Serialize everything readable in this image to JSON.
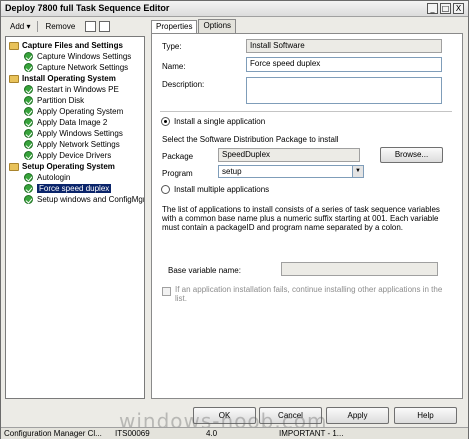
{
  "window": {
    "title": "Deploy 7800 full Task Sequence Editor",
    "controls": [
      "_",
      "□",
      "X"
    ]
  },
  "toolbar": {
    "add_label": "Add",
    "remove_label": "Remove"
  },
  "tree": {
    "items": [
      {
        "label": "Capture Files and Settings",
        "type": "group"
      },
      {
        "label": "Capture Windows Settings",
        "type": "step"
      },
      {
        "label": "Capture Network Settings",
        "type": "step"
      },
      {
        "label": "Install Operating System",
        "type": "group"
      },
      {
        "label": "Restart in Windows PE",
        "type": "step"
      },
      {
        "label": "Partition Disk",
        "type": "step"
      },
      {
        "label": "Apply Operating System",
        "type": "step"
      },
      {
        "label": "Apply Data Image 2",
        "type": "step"
      },
      {
        "label": "Apply Windows Settings",
        "type": "step"
      },
      {
        "label": "Apply Network Settings",
        "type": "step"
      },
      {
        "label": "Apply Device Drivers",
        "type": "step"
      },
      {
        "label": "Setup Operating System",
        "type": "group"
      },
      {
        "label": "Autologin",
        "type": "step"
      },
      {
        "label": "Force speed duplex",
        "type": "step",
        "selected": true
      },
      {
        "label": "Setup windows and ConfigMgr",
        "type": "step"
      }
    ]
  },
  "tabs": {
    "properties": "Properties",
    "options": "Options"
  },
  "props": {
    "type_label": "Type:",
    "type_value": "Install Software",
    "name_label": "Name:",
    "name_value": "Force speed duplex",
    "description_label": "Description:",
    "description_value": "",
    "radio_single": "Install a single application",
    "select_package_text": "Select the Software Distribution Package to install",
    "package_label": "Package",
    "package_value": "SpeedDuplex",
    "browse_label": "Browse...",
    "program_label": "Program",
    "program_value": "setup",
    "radio_multiple": "Install multiple applications",
    "multiple_desc": "The list of applications to install consists of a series of task sequence variables with a common base name plus a numeric suffix starting at 001.  Each variable must contain a packageID and program name separated by a colon.",
    "base_variable_label": "Base variable name:",
    "base_variable_value": "",
    "continue_checkbox": "If an application installation fails, continue installing other applications in the list."
  },
  "buttons": {
    "ok": "OK",
    "cancel": "Cancel",
    "apply": "Apply",
    "help": "Help"
  },
  "status": {
    "app": "Configuration Manager Cl...",
    "site": "ITS00069",
    "version": "4.0",
    "info": "IMPORTANT - 1..."
  },
  "watermark": "windows-noob.com",
  "colors": {
    "selection": "#0a246a",
    "step_check": "#37a33b",
    "folder": "#e8c25a"
  }
}
